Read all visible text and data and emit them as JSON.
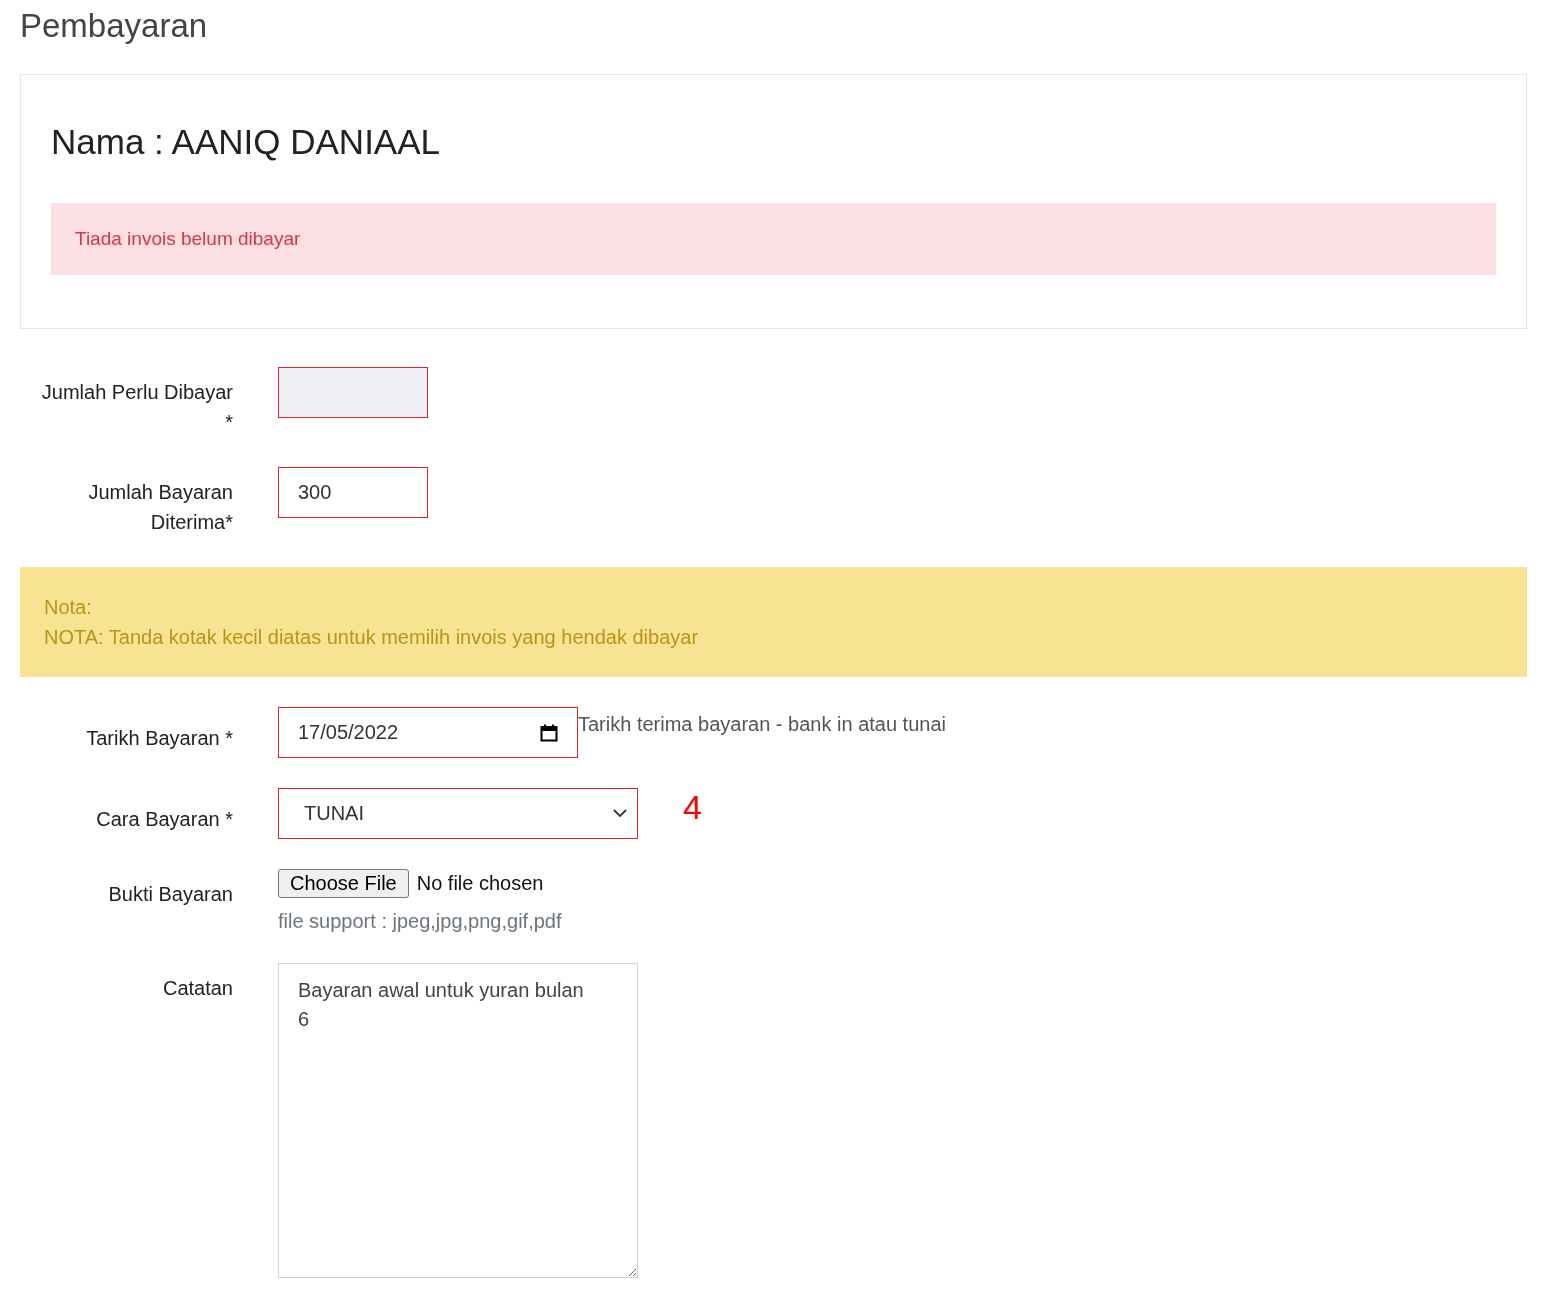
{
  "page_title": "Pembayaran",
  "card": {
    "heading": "Nama : AANIQ DANIAAL",
    "alert": "Tiada invois belum dibayar"
  },
  "amount_fields": [
    {
      "label": "Jumlah Perlu Dibayar *",
      "invalid": true,
      "readonly": true
    },
    {
      "label": "Jumlah Bayaran Diterima*",
      "value": "300",
      "invalid": true,
      "readonly": false
    }
  ],
  "note": {
    "title": "Nota:",
    "text": "NOTA: Tanda kotak kecil diatas untuk memilih invois yang hendak dibayar"
  },
  "date_field": {
    "label": "Tarikh Bayaran *",
    "value": "17/05/2022",
    "invalid": true,
    "help": "Tarikh terima bayaran - bank in atau tunai"
  },
  "method_field": {
    "label": "Cara Bayaran *",
    "value": "TUNAI",
    "invalid": true,
    "annotation": "4"
  },
  "file_field": {
    "label": "Bukti Bayaran",
    "button": "Choose File",
    "status": "No file chosen",
    "hint": "file support : jpeg,jpg,png,gif,pdf"
  },
  "notes_field": {
    "label": "Catatan",
    "value": "Bayaran awal untuk yuran bulan 6",
    "invalid": false
  }
}
